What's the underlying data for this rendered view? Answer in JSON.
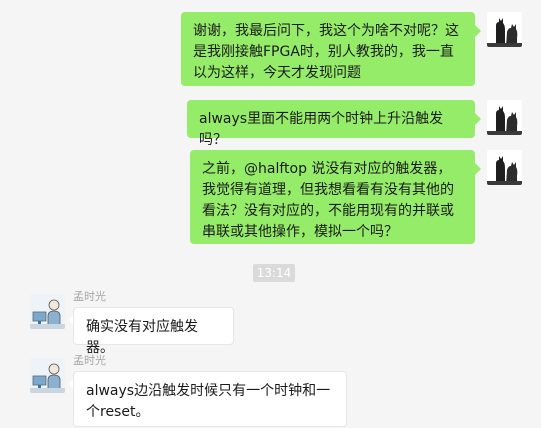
{
  "messages": [
    {
      "from": "me",
      "text": "谢谢，我最后问下，我这个为啥不对呢？这是我刚接触FPGA时，别人教我的，我一直以为这样，今天才发现问题"
    },
    {
      "from": "me",
      "text": "always里面不能用两个时钟上升沿触发吗？"
    },
    {
      "from": "me",
      "text": "之前，@halftop 说没有对应的触发器，我觉得有道理，但我想看看有没有其他的看法？没有对应的，不能用现有的并联或串联或其他操作，模拟一个吗？"
    },
    {
      "from": "other",
      "sender": "孟时光",
      "text": "确实没有对应触发器。"
    },
    {
      "from": "other",
      "sender": "孟时光",
      "text": "always边沿触发时候只有一个时钟和一个reset。"
    }
  ],
  "timestamp": "13:14",
  "colors": {
    "my_bubble": "#95ec69",
    "other_bubble": "#ffffff",
    "background": "#f5f5f5",
    "timestamp_bg": "#dadada"
  }
}
